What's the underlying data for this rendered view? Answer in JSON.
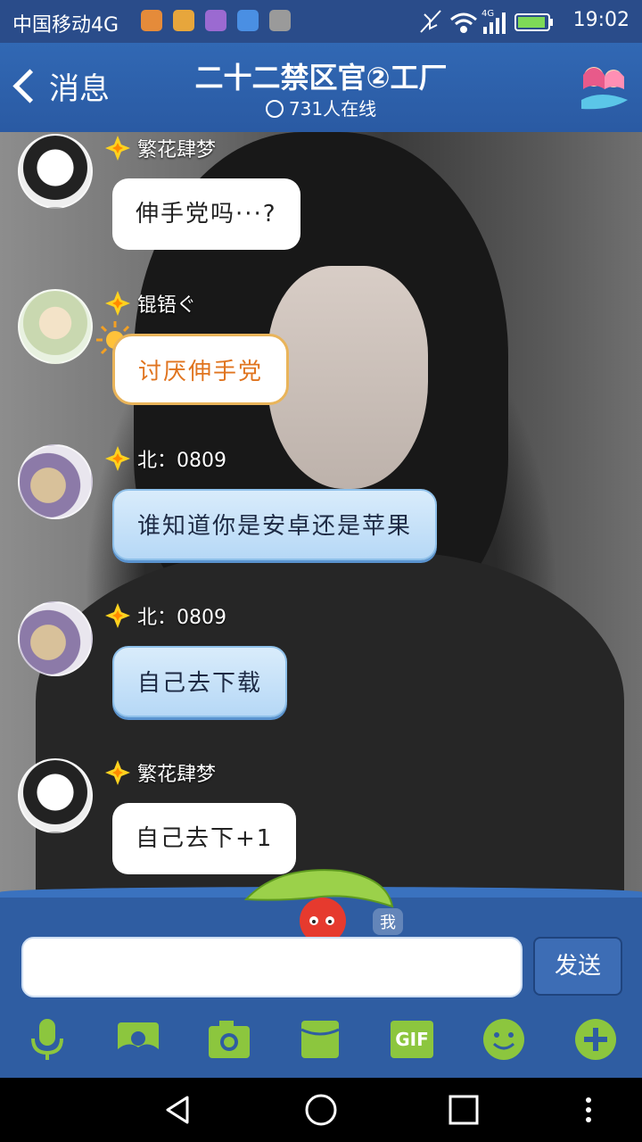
{
  "status_bar": {
    "carrier": "中国移动4G",
    "network": "4G",
    "time": "19:02"
  },
  "header": {
    "back_label": "消息",
    "title": "二十二禁区官②工厂",
    "online": "731人在线"
  },
  "messages": [
    {
      "sender": "繁花肆梦",
      "text": "伸手党吗···?",
      "style": "white"
    },
    {
      "sender": "锟铻ぐ",
      "text": "讨厌伸手党",
      "style": "orange"
    },
    {
      "sender": "北：0809",
      "text": "谁知道你是安卓还是苹果",
      "style": "blue"
    },
    {
      "sender": "北：0809",
      "text": "自己去下载",
      "style": "blue"
    },
    {
      "sender": "繁花肆梦",
      "text": "自己去下+1",
      "style": "white"
    }
  ],
  "input": {
    "me_label": "我",
    "placeholder": "",
    "send_label": "发送"
  },
  "toolbar": {
    "items": [
      "mic-icon",
      "image-icon",
      "camera-icon",
      "folder-icon",
      "gif-icon",
      "emoji-icon",
      "plus-icon"
    ],
    "gif_label": "GIF"
  },
  "colors": {
    "header": "#2a5aa3",
    "accent_green": "#8cc63e",
    "bubble_blue": "#c4e1f8",
    "orange_text": "#e0741f"
  }
}
